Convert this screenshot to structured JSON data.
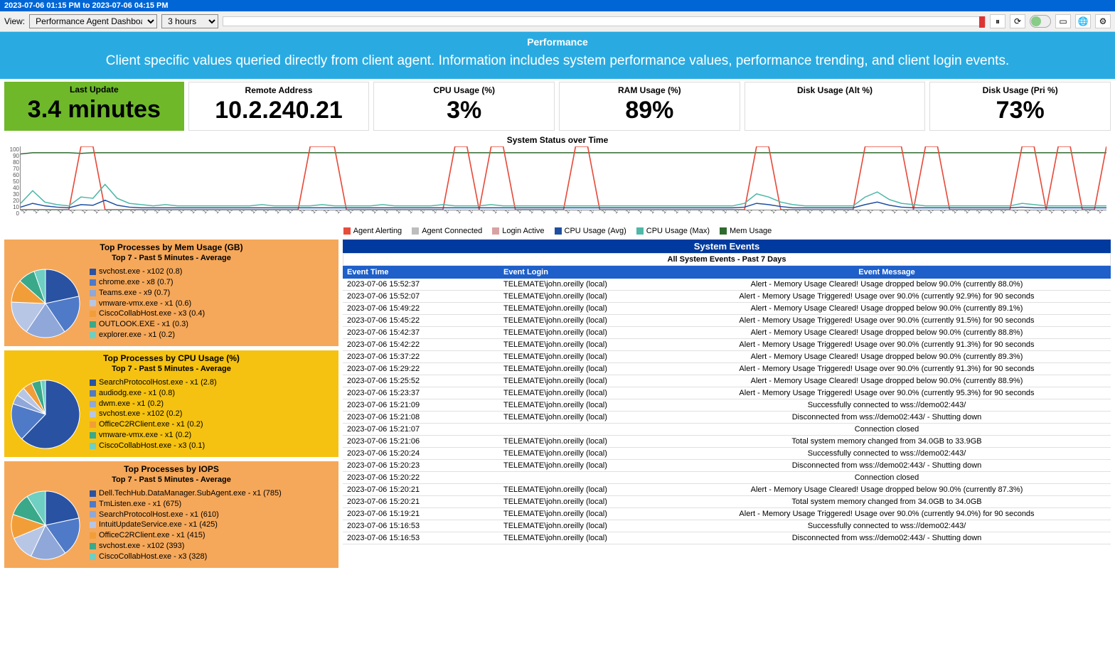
{
  "date_range": "2023-07-06 01:15 PM  to  2023-07-06 04:15 PM",
  "toolbar": {
    "view_label": "View:",
    "view_value": "Performance Agent Dashboard",
    "time_value": "3 hours",
    "icons": {
      "pause": "pause-icon",
      "refresh": "refresh-icon",
      "lock": "lock-icon",
      "rect": "window-icon",
      "globe": "globe-icon",
      "gear": "gear-icon"
    }
  },
  "banner": {
    "title": "Performance",
    "desc": "Client specific values queried directly from client agent. Information includes system performance values, performance trending, and client login events."
  },
  "metrics": {
    "last_update": {
      "label": "Last Update",
      "value": "3.4 minutes"
    },
    "remote": {
      "label": "Remote Address",
      "value": "10.2.240.21"
    },
    "cpu": {
      "label": "CPU Usage (%)",
      "value": "3%"
    },
    "ram": {
      "label": "RAM Usage (%)",
      "value": "89%"
    },
    "disk_alt": {
      "label": "Disk Usage (Alt %)",
      "value": ""
    },
    "disk_pri": {
      "label": "Disk Usage (Pri %)",
      "value": "73%"
    }
  },
  "chart": {
    "title": "System Status over Time",
    "y_ticks": [
      "100",
      "90",
      "80",
      "70",
      "60",
      "50",
      "40",
      "30",
      "20",
      "10",
      "0"
    ],
    "x_ticks": [
      "13:00",
      "13:02",
      "13:04",
      "13:06",
      "13:08",
      "13:10",
      "13:12",
      "13:14",
      "13:16",
      "13:18",
      "13:20",
      "13:22",
      "13:24",
      "13:26",
      "13:28",
      "13:30",
      "13:32",
      "13:34",
      "13:36",
      "13:38",
      "13:40",
      "13:42",
      "13:44",
      "13:46",
      "13:48",
      "13:50",
      "13:52",
      "13:54",
      "13:56",
      "13:58",
      "14:00",
      "14:02",
      "14:04",
      "14:06",
      "14:08",
      "14:10",
      "14:12",
      "14:14",
      "14:16",
      "14:18",
      "14:20",
      "14:22",
      "14:24",
      "14:26",
      "14:28",
      "14:30",
      "14:32",
      "14:34",
      "14:36",
      "14:38",
      "14:40",
      "14:42",
      "14:44",
      "14:46",
      "14:48",
      "14:50",
      "14:52",
      "14:54",
      "14:56",
      "14:58",
      "15:00",
      "15:02",
      "15:04",
      "15:06",
      "15:08",
      "15:10",
      "15:12",
      "15:14",
      "15:16",
      "15:18",
      "15:20",
      "15:22",
      "15:24",
      "15:26",
      "15:28",
      "15:30",
      "15:32",
      "15:34",
      "15:36",
      "15:38",
      "15:40",
      "15:42",
      "15:44",
      "15:46",
      "15:48",
      "15:50",
      "15:52",
      "15:54",
      "15:56",
      "15:58",
      "16:00"
    ],
    "legend": [
      {
        "label": "Agent Alerting",
        "color": "#e74c3c"
      },
      {
        "label": "Agent Connected",
        "color": "#bdbdbd"
      },
      {
        "label": "Login Active",
        "color": "#d9a2a2"
      },
      {
        "label": "CPU Usage (Avg)",
        "color": "#1e4fa0"
      },
      {
        "label": "CPU Usage (Max)",
        "color": "#4fb8a8"
      },
      {
        "label": "Mem Usage",
        "color": "#2e6b2e"
      }
    ]
  },
  "chart_data": {
    "type": "line",
    "xlabel": "",
    "ylabel": "",
    "ylim": [
      0,
      100
    ],
    "x": [
      "13:00",
      "13:02",
      "13:04",
      "13:06",
      "13:08",
      "13:10",
      "13:12",
      "13:14",
      "13:16",
      "13:18",
      "13:20",
      "13:22",
      "13:24",
      "13:26",
      "13:28",
      "13:30",
      "13:32",
      "13:34",
      "13:36",
      "13:38",
      "13:40",
      "13:42",
      "13:44",
      "13:46",
      "13:48",
      "13:50",
      "13:52",
      "13:54",
      "13:56",
      "13:58",
      "14:00",
      "14:02",
      "14:04",
      "14:06",
      "14:08",
      "14:10",
      "14:12",
      "14:14",
      "14:16",
      "14:18",
      "14:20",
      "14:22",
      "14:24",
      "14:26",
      "14:28",
      "14:30",
      "14:32",
      "14:34",
      "14:36",
      "14:38",
      "14:40",
      "14:42",
      "14:44",
      "14:46",
      "14:48",
      "14:50",
      "14:52",
      "14:54",
      "14:56",
      "14:58",
      "15:00",
      "15:02",
      "15:04",
      "15:06",
      "15:08",
      "15:10",
      "15:12",
      "15:14",
      "15:16",
      "15:18",
      "15:20",
      "15:22",
      "15:24",
      "15:26",
      "15:28",
      "15:30",
      "15:32",
      "15:34",
      "15:36",
      "15:38",
      "15:40",
      "15:42",
      "15:44",
      "15:46",
      "15:48",
      "15:50",
      "15:52",
      "15:54",
      "15:56",
      "15:58",
      "16:00"
    ],
    "series": [
      {
        "name": "Mem Usage",
        "color": "#2e6b2e",
        "values": [
          88,
          90,
          90,
          90,
          90,
          89,
          90,
          90,
          90,
          90,
          90,
          90,
          90,
          90,
          90,
          90,
          90,
          90,
          90,
          90,
          90,
          90,
          90,
          90,
          90,
          90,
          90,
          90,
          90,
          90,
          90,
          90,
          90,
          90,
          90,
          90,
          90,
          90,
          90,
          90,
          90,
          90,
          90,
          90,
          90,
          90,
          90,
          90,
          90,
          90,
          90,
          90,
          90,
          90,
          90,
          90,
          90,
          90,
          90,
          90,
          90,
          90,
          90,
          90,
          90,
          90,
          90,
          90,
          90,
          90,
          90,
          90,
          90,
          90,
          90,
          90,
          90,
          90,
          90,
          90,
          90,
          90,
          90,
          90,
          90,
          90,
          90,
          90,
          90,
          90,
          90
        ]
      },
      {
        "name": "Agent Alerting",
        "color": "#e74c3c",
        "values": [
          0,
          0,
          0,
          0,
          0,
          100,
          100,
          0,
          0,
          0,
          0,
          0,
          0,
          0,
          0,
          0,
          0,
          0,
          0,
          0,
          0,
          0,
          0,
          0,
          100,
          100,
          100,
          0,
          0,
          0,
          0,
          0,
          0,
          0,
          0,
          0,
          100,
          100,
          0,
          100,
          100,
          0,
          0,
          0,
          0,
          0,
          100,
          100,
          0,
          0,
          0,
          0,
          0,
          0,
          0,
          0,
          0,
          0,
          0,
          0,
          0,
          100,
          100,
          0,
          0,
          0,
          0,
          0,
          0,
          0,
          100,
          100,
          100,
          100,
          0,
          100,
          100,
          0,
          0,
          0,
          0,
          0,
          0,
          100,
          100,
          0,
          100,
          100,
          0,
          0,
          100
        ]
      },
      {
        "name": "CPU Usage (Max)",
        "color": "#4fb8a8",
        "values": [
          10,
          30,
          12,
          8,
          6,
          20,
          18,
          40,
          18,
          10,
          8,
          6,
          8,
          6,
          6,
          6,
          6,
          6,
          6,
          6,
          8,
          6,
          6,
          6,
          6,
          8,
          6,
          6,
          6,
          6,
          8,
          6,
          6,
          6,
          6,
          8,
          6,
          6,
          6,
          8,
          6,
          6,
          6,
          6,
          6,
          6,
          6,
          6,
          6,
          6,
          6,
          6,
          6,
          6,
          6,
          6,
          6,
          6,
          6,
          6,
          10,
          25,
          20,
          12,
          8,
          6,
          6,
          6,
          6,
          6,
          20,
          28,
          16,
          10,
          8,
          6,
          6,
          6,
          6,
          6,
          6,
          6,
          6,
          10,
          8,
          6,
          6,
          6,
          6,
          6,
          6
        ]
      },
      {
        "name": "CPU Usage (Avg)",
        "color": "#1e4fa0",
        "values": [
          4,
          10,
          6,
          4,
          3,
          8,
          7,
          15,
          7,
          4,
          3,
          3,
          3,
          3,
          3,
          3,
          3,
          3,
          3,
          3,
          3,
          3,
          3,
          3,
          3,
          3,
          3,
          3,
          3,
          3,
          3,
          3,
          3,
          3,
          3,
          3,
          3,
          3,
          3,
          3,
          3,
          3,
          3,
          3,
          3,
          3,
          3,
          3,
          3,
          3,
          3,
          3,
          3,
          3,
          3,
          3,
          3,
          3,
          3,
          3,
          4,
          10,
          8,
          5,
          3,
          3,
          3,
          3,
          3,
          3,
          8,
          12,
          7,
          4,
          3,
          3,
          3,
          3,
          3,
          3,
          3,
          3,
          3,
          4,
          3,
          3,
          3,
          3,
          3,
          3,
          3
        ]
      }
    ]
  },
  "processes": {
    "mem": {
      "title": "Top Processes by Mem Usage (GB)",
      "sub": "Top 7 - Past 5 Minutes - Average",
      "items": [
        {
          "label": "svchost.exe - x102 (0.8)",
          "color": "#2952a3",
          "value": 0.8
        },
        {
          "label": "chrome.exe - x8 (0.7)",
          "color": "#4f7ac7",
          "value": 0.7
        },
        {
          "label": "Teams.exe - x9 (0.7)",
          "color": "#8fa8d9",
          "value": 0.7
        },
        {
          "label": "vmware-vmx.exe - x1 (0.6)",
          "color": "#b8c6e6",
          "value": 0.6
        },
        {
          "label": "CiscoCollabHost.exe - x3 (0.4)",
          "color": "#f29e38",
          "value": 0.4
        },
        {
          "label": "OUTLOOK.EXE - x1 (0.3)",
          "color": "#3aa98a",
          "value": 0.3
        },
        {
          "label": "explorer.exe - x1 (0.2)",
          "color": "#6ecfc2",
          "value": 0.2
        }
      ]
    },
    "cpu": {
      "title": "Top Processes by CPU Usage (%)",
      "sub": "Top 7 - Past 5 Minutes - Average",
      "items": [
        {
          "label": "SearchProtocolHost.exe - x1 (2.8)",
          "color": "#2952a3",
          "value": 2.8
        },
        {
          "label": "audiodg.exe - x1 (0.8)",
          "color": "#4f7ac7",
          "value": 0.8
        },
        {
          "label": "dwm.exe - x1 (0.2)",
          "color": "#8fa8d9",
          "value": 0.2
        },
        {
          "label": "svchost.exe - x102 (0.2)",
          "color": "#b8c6e6",
          "value": 0.2
        },
        {
          "label": "OfficeC2RClient.exe - x1 (0.2)",
          "color": "#f29e38",
          "value": 0.2
        },
        {
          "label": "vmware-vmx.exe - x1 (0.2)",
          "color": "#3aa98a",
          "value": 0.2
        },
        {
          "label": "CiscoCollabHost.exe - x3 (0.1)",
          "color": "#6ecfc2",
          "value": 0.1
        }
      ]
    },
    "iops": {
      "title": "Top Processes by IOPS",
      "sub": "Top 7 - Past 5 Minutes - Average",
      "items": [
        {
          "label": "Dell.TechHub.DataManager.SubAgent.exe - x1 (785)",
          "color": "#2952a3",
          "value": 785
        },
        {
          "label": "TmListen.exe - x1 (675)",
          "color": "#4f7ac7",
          "value": 675
        },
        {
          "label": "SearchProtocolHost.exe - x1 (610)",
          "color": "#8fa8d9",
          "value": 610
        },
        {
          "label": "IntuitUpdateService.exe - x1 (425)",
          "color": "#b8c6e6",
          "value": 425
        },
        {
          "label": "OfficeC2RClient.exe - x1 (415)",
          "color": "#f29e38",
          "value": 415
        },
        {
          "label": "svchost.exe - x102 (393)",
          "color": "#3aa98a",
          "value": 393
        },
        {
          "label": "CiscoCollabHost.exe - x3 (328)",
          "color": "#6ecfc2",
          "value": 328
        }
      ]
    }
  },
  "events": {
    "header": "System Events",
    "sub": "All System Events - Past 7 Days",
    "columns": [
      "Event Time",
      "Event Login",
      "Event Message"
    ],
    "rows": [
      [
        "2023-07-06 15:52:37",
        "TELEMATE\\john.oreilly (local)",
        "Alert - Memory Usage Cleared! Usage dropped below 90.0% (currently 88.0%)"
      ],
      [
        "2023-07-06 15:52:07",
        "TELEMATE\\john.oreilly (local)",
        "Alert - Memory Usage Triggered! Usage over 90.0% (currently 92.9%) for 90 seconds"
      ],
      [
        "2023-07-06 15:49:22",
        "TELEMATE\\john.oreilly (local)",
        "Alert - Memory Usage Cleared! Usage dropped below 90.0% (currently 89.1%)"
      ],
      [
        "2023-07-06 15:45:22",
        "TELEMATE\\john.oreilly (local)",
        "Alert - Memory Usage Triggered! Usage over 90.0% (currently 91.5%) for 90 seconds"
      ],
      [
        "2023-07-06 15:42:37",
        "TELEMATE\\john.oreilly (local)",
        "Alert - Memory Usage Cleared! Usage dropped below 90.0% (currently 88.8%)"
      ],
      [
        "2023-07-06 15:42:22",
        "TELEMATE\\john.oreilly (local)",
        "Alert - Memory Usage Triggered! Usage over 90.0% (currently 91.3%) for 90 seconds"
      ],
      [
        "2023-07-06 15:37:22",
        "TELEMATE\\john.oreilly (local)",
        "Alert - Memory Usage Cleared! Usage dropped below 90.0% (currently 89.3%)"
      ],
      [
        "2023-07-06 15:29:22",
        "TELEMATE\\john.oreilly (local)",
        "Alert - Memory Usage Triggered! Usage over 90.0% (currently 91.3%) for 90 seconds"
      ],
      [
        "2023-07-06 15:25:52",
        "TELEMATE\\john.oreilly (local)",
        "Alert - Memory Usage Cleared! Usage dropped below 90.0% (currently 88.9%)"
      ],
      [
        "2023-07-06 15:23:37",
        "TELEMATE\\john.oreilly (local)",
        "Alert - Memory Usage Triggered! Usage over 90.0% (currently 95.3%) for 90 seconds"
      ],
      [
        "2023-07-06 15:21:09",
        "TELEMATE\\john.oreilly (local)",
        "Successfully connected to wss://demo02:443/"
      ],
      [
        "2023-07-06 15:21:08",
        "TELEMATE\\john.oreilly (local)",
        "Disconnected from wss://demo02:443/ - Shutting down"
      ],
      [
        "2023-07-06 15:21:07",
        "",
        "Connection closed"
      ],
      [
        "2023-07-06 15:21:06",
        "TELEMATE\\john.oreilly (local)",
        "Total system memory changed from 34.0GB to 33.9GB"
      ],
      [
        "2023-07-06 15:20:24",
        "TELEMATE\\john.oreilly (local)",
        "Successfully connected to wss://demo02:443/"
      ],
      [
        "2023-07-06 15:20:23",
        "TELEMATE\\john.oreilly (local)",
        "Disconnected from wss://demo02:443/ - Shutting down"
      ],
      [
        "2023-07-06 15:20:22",
        "",
        "Connection closed"
      ],
      [
        "2023-07-06 15:20:21",
        "TELEMATE\\john.oreilly (local)",
        "Alert - Memory Usage Cleared! Usage dropped below 90.0% (currently 87.3%)"
      ],
      [
        "2023-07-06 15:20:21",
        "TELEMATE\\john.oreilly (local)",
        "Total system memory changed from 34.0GB to 34.0GB"
      ],
      [
        "2023-07-06 15:19:21",
        "TELEMATE\\john.oreilly (local)",
        "Alert - Memory Usage Triggered! Usage over 90.0% (currently 94.0%) for 90 seconds"
      ],
      [
        "2023-07-06 15:16:53",
        "TELEMATE\\john.oreilly (local)",
        "Successfully connected to wss://demo02:443/"
      ],
      [
        "2023-07-06 15:16:53",
        "TELEMATE\\john.oreilly (local)",
        "Disconnected from wss://demo02:443/ - Shutting down"
      ]
    ]
  }
}
